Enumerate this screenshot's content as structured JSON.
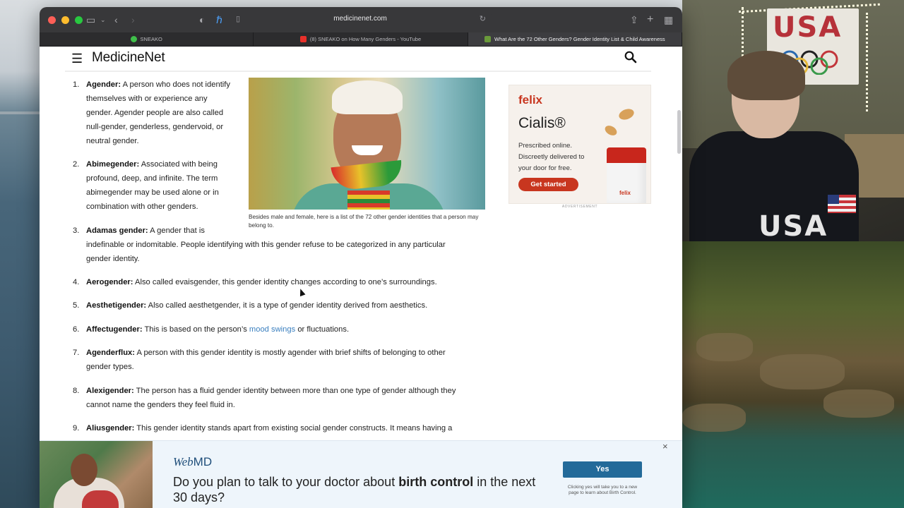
{
  "browser": {
    "url": "medicinenet.com",
    "tabs": [
      {
        "label": "SNEAKO",
        "favicon": "green-circle-icon"
      },
      {
        "label": "(8) SNEAKO on How Many Genders - YouTube",
        "favicon": "youtube-icon"
      },
      {
        "label": "What Are the 72 Other Genders? Gender Identity List & Child Awareness",
        "favicon": "medicinenet-icon"
      }
    ]
  },
  "site": {
    "logo": "MedicineNet"
  },
  "article": {
    "caption": "Besides male and female, here is a list of the 72 other gender identities that a person may belong to.",
    "items": [
      {
        "num": "1.",
        "term": "Agender:",
        "lines": [
          "A person who does not identify",
          "themselves with or experience any",
          "gender. Agender people are also called",
          "null-gender, genderless, gendervoid, or",
          "neutral gender."
        ]
      },
      {
        "num": "2.",
        "term": "Abimegender:",
        "lines": [
          "Associated with being",
          "profound, deep, and infinite. The term",
          "abimegender may be used alone or in",
          "combination with other genders."
        ]
      },
      {
        "num": "3.",
        "term": "Adamas gender:",
        "lines": [
          "A gender that is",
          "indefinable or indomitable. People identifying with this gender refuse to be categorized in any particular",
          "gender identity."
        ]
      },
      {
        "num": "4.",
        "term": "Aerogender:",
        "lines": [
          "Also called evaisgender, this gender identity changes according to one’s surroundings."
        ]
      },
      {
        "num": "5.",
        "term": "Aesthetigender:",
        "lines": [
          "Also called aesthetgender, it is a type of gender identity derived from aesthetics."
        ]
      },
      {
        "num": "6.",
        "term": "Affectugender:",
        "pre": "This is based on the person’s",
        "link": "mood swings",
        "post": "or fluctuations."
      },
      {
        "num": "7.",
        "term": "Agenderflux:",
        "lines": [
          "A person with this gender identity is mostly agender with brief shifts of belonging to other",
          "gender types."
        ]
      },
      {
        "num": "8.",
        "term": "Alexigender:",
        "lines": [
          "The person has a fluid gender identity between more than one type of gender although they",
          "cannot name the genders they feel fluid in."
        ]
      },
      {
        "num": "9.",
        "term": "Aliusgender:",
        "lines": [
          "This gender identity stands apart from existing social gender constructs. It means having a"
        ]
      }
    ]
  },
  "ad": {
    "brand": "felix",
    "product": "Cialis®",
    "copy": [
      "Prescribed online.",
      "Discreetly delivered to",
      "your door for free."
    ],
    "cta": "Get started",
    "bottle_label": "felix",
    "label": "ADVERTISEMENT"
  },
  "banner": {
    "brand_web": "Web",
    "brand_md": "MD",
    "question_pre": "Do you plan to talk to your doctor about",
    "question_bold": "birth control",
    "question_post": "in the next 30 days?",
    "yes": "Yes",
    "note": "Clicking yes will take you to a new page to learn about Birth Control.",
    "close": "×"
  }
}
